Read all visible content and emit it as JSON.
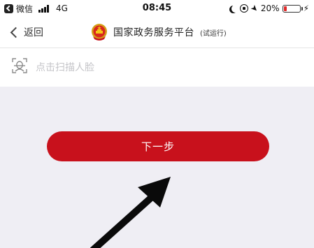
{
  "status_bar": {
    "carrier": "微信",
    "network": "4G",
    "time": "08:45",
    "battery_text": "20%",
    "battery_level": 0.2,
    "icons": [
      "back-to-app-icon",
      "signal-icon",
      "moon-icon",
      "rotation-lock-icon",
      "location-icon",
      "battery-icon",
      "charging-icon"
    ]
  },
  "nav": {
    "back_label": "返回",
    "title": "国家政务服务平台",
    "title_suffix": "(试运行)",
    "icons": [
      "chevron-left-icon",
      "national-emblem-icon"
    ]
  },
  "scan": {
    "label": "点击扫描人脸",
    "icon": "face-scan-icon"
  },
  "next_button": {
    "label": "下一步"
  },
  "colors": {
    "accent": "#c8111c",
    "battery": "#e02a2a",
    "page_background": "#efeef4",
    "placeholder_text": "#c4c4c8"
  }
}
